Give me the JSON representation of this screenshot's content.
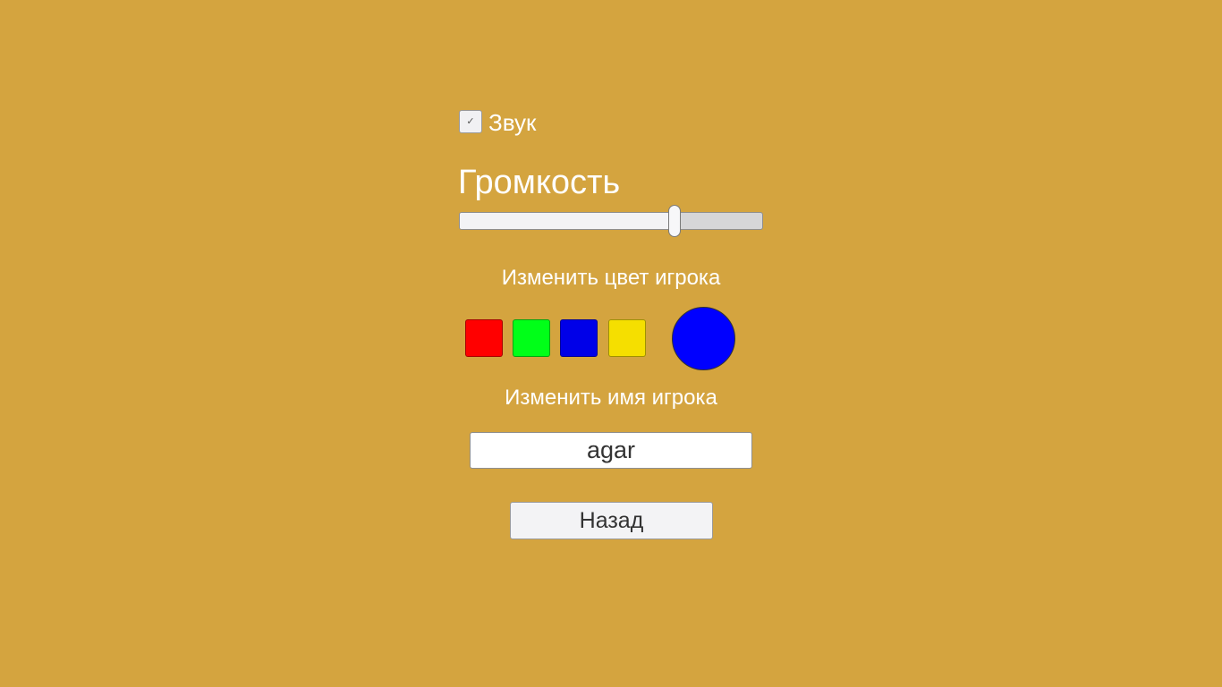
{
  "sound": {
    "label": "Звук",
    "checked": true,
    "check_glyph": "✓"
  },
  "volume": {
    "title": "Громкость",
    "value": 0.71
  },
  "color": {
    "title": "Изменить цвет игрока",
    "swatches": [
      {
        "name": "red",
        "hex": "#ff0000"
      },
      {
        "name": "green",
        "hex": "#00ff18"
      },
      {
        "name": "blue",
        "hex": "#0000e8"
      },
      {
        "name": "yellow",
        "hex": "#f5df00"
      }
    ],
    "current_hex": "#0000ff"
  },
  "name": {
    "title": "Изменить имя игрока",
    "value": "agar"
  },
  "back": {
    "label": "Назад"
  },
  "colors": {
    "background": "#d4a43f",
    "text": "#ffffff"
  }
}
